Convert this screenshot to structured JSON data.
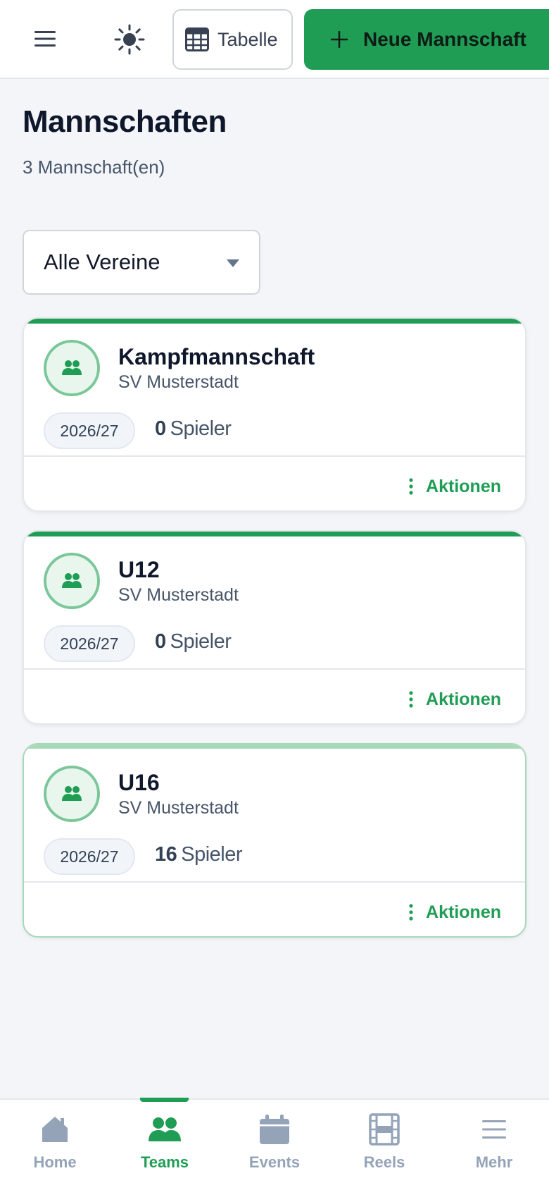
{
  "header": {
    "menu_icon": "hamburger-icon",
    "theme_icon": "sun-icon",
    "table_button_label": "Tabelle",
    "new_team_button_label": "Neue Mannschaft"
  },
  "page": {
    "title": "Mannschaften",
    "subtitle": "3 Mannschaft(en)"
  },
  "filter": {
    "selected": "Alle Vereine"
  },
  "teams": [
    {
      "name": "Kampfmannschaft",
      "club": "SV Musterstadt",
      "season": "2026/27",
      "players": "0",
      "players_label": "Spieler",
      "actions_label": "Aktionen"
    },
    {
      "name": "U12",
      "club": "SV Musterstadt",
      "season": "2026/27",
      "players": "0",
      "players_label": "Spieler",
      "actions_label": "Aktionen"
    },
    {
      "name": "U16",
      "club": "SV Musterstadt",
      "season": "2026/27",
      "players": "16",
      "players_label": "Spieler",
      "actions_label": "Aktionen"
    }
  ],
  "bottom_nav": [
    {
      "label": "Home",
      "icon": "home-icon"
    },
    {
      "label": "Teams",
      "icon": "teams-icon",
      "active": true
    },
    {
      "label": "Events",
      "icon": "calendar-icon"
    },
    {
      "label": "Reels",
      "icon": "film-icon"
    },
    {
      "label": "Mehr",
      "icon": "menu-icon"
    }
  ],
  "colors": {
    "accent": "#1f9d55",
    "background": "#f3f5f9",
    "muted": "#94a3b8"
  }
}
